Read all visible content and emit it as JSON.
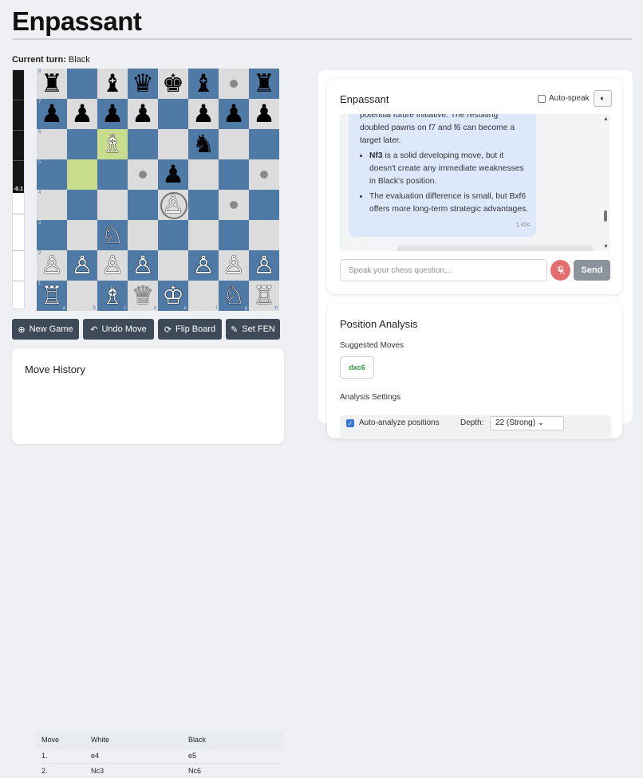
{
  "app": {
    "title": "Enpassant"
  },
  "turn": {
    "label": "Current turn:",
    "value": "Black"
  },
  "eval": {
    "label": "-0.1",
    "black_fraction": 0.49
  },
  "board": {
    "orientation": "white",
    "files": [
      "a",
      "b",
      "c",
      "d",
      "e",
      "f",
      "g",
      "h"
    ],
    "ranks": [
      "8",
      "7",
      "6",
      "5",
      "4",
      "3",
      "2",
      "1"
    ],
    "rows": [
      [
        "bR",
        "",
        "bB",
        "bQ",
        "bK",
        "bB",
        "",
        "bR"
      ],
      [
        "bP",
        "bP",
        "bP",
        "bP",
        "",
        "bP",
        "bP",
        "bP"
      ],
      [
        "",
        "",
        "wB",
        "",
        "",
        "bN",
        "",
        ""
      ],
      [
        "",
        "",
        "",
        "",
        "bP",
        "",
        "",
        ""
      ],
      [
        "",
        "",
        "",
        "",
        "wP",
        "",
        "",
        ""
      ],
      [
        "",
        "",
        "wN",
        "",
        "",
        "",
        "",
        ""
      ],
      [
        "wP",
        "wP",
        "wP",
        "wP",
        "",
        "wP",
        "wP",
        "wP"
      ],
      [
        "wR",
        "",
        "wB",
        "wQ",
        "wK",
        "",
        "wN",
        "wR"
      ]
    ],
    "last_move": [
      "b5",
      "c6"
    ],
    "move_dots": [
      "g8",
      "d5",
      "h5",
      "g4"
    ],
    "capture_rings": [
      "e4"
    ]
  },
  "controls": {
    "new_game": "New Game",
    "undo_move": "Undo Move",
    "flip_board": "Flip Board",
    "set_fen": "Set FEN"
  },
  "history": {
    "title": "Move History",
    "headers": [
      "Move",
      "White",
      "Black"
    ],
    "rows": [
      [
        "1.",
        "e4",
        "e5"
      ],
      [
        "2.",
        "Nc3",
        "Nc6"
      ]
    ]
  },
  "chat": {
    "title": "Enpassant",
    "auto_speak_label": "Auto-speak",
    "message_intro": "potential future initiative. The resulting doubled pawns on f7 and f6 can become a target later.",
    "bullets": [
      {
        "strong": "Nf3",
        "text": " is a solid developing move, but it doesn't create any immediate weaknesses in Black's position."
      },
      {
        "strong": "",
        "text": "The evaluation difference is small, but Bxf6 offers more long-term strategic advantages."
      }
    ],
    "message_time": "1.42s",
    "input_placeholder": "Speak your chess question...",
    "send_label": "Send"
  },
  "analysis": {
    "title": "Position Analysis",
    "suggested_label": "Suggested Moves",
    "suggested_moves": [
      "dxc6"
    ],
    "settings_label": "Analysis Settings",
    "auto_analyze_label": "Auto-analyze positions",
    "depth_label": "Depth:",
    "depth_value": "22 (Strong)"
  },
  "icons": {
    "new_game": "plus-circle-icon",
    "undo_move": "undo-icon",
    "flip_board": "refresh-icon",
    "set_fen": "edit-icon",
    "speaker": "speaker-icon",
    "mic": "mic-off-icon"
  }
}
